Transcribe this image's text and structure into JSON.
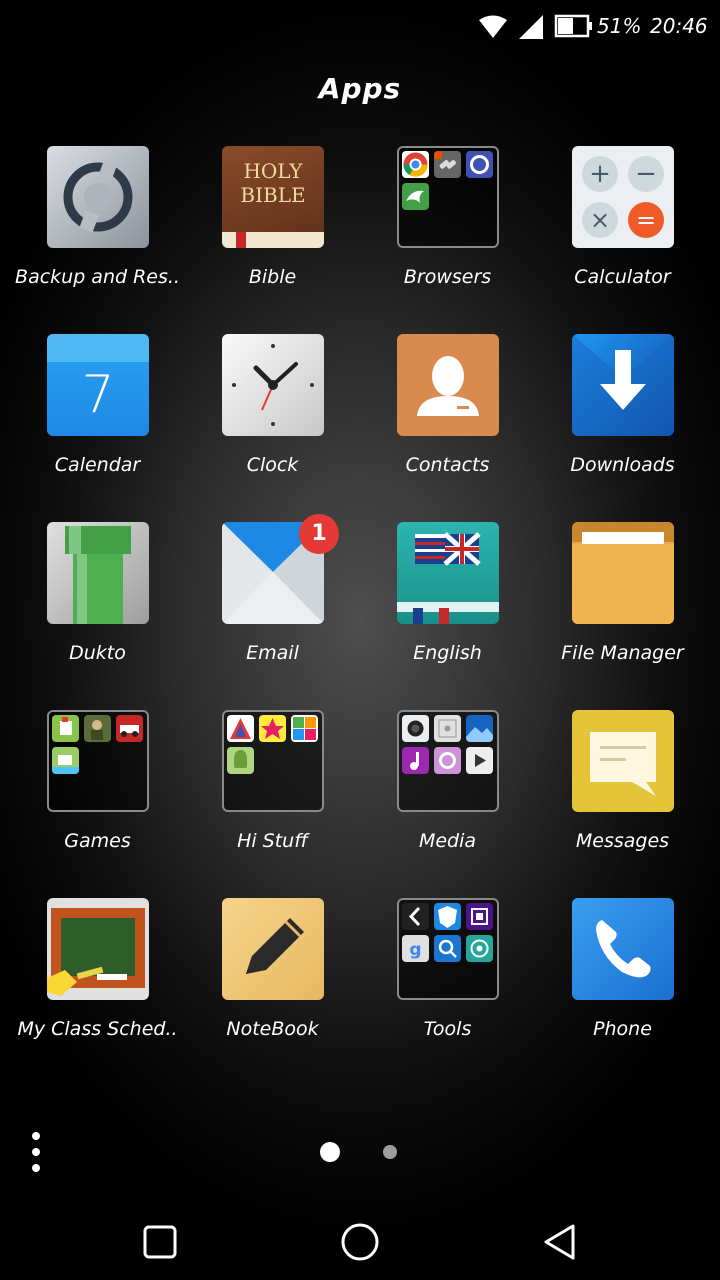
{
  "status_bar": {
    "battery": "51%",
    "time": "20:46",
    "wifi_icon": "wifi-icon",
    "signal_icon": "signal-icon",
    "battery_icon": "battery-icon"
  },
  "page": {
    "title": "Apps"
  },
  "apps": [
    {
      "label": "Backup and Res..",
      "icon": "backup-restore-icon"
    },
    {
      "label": "Bible",
      "icon": "holy-bible-icon",
      "icon_text_1": "HOLY",
      "icon_text_2": "BIBLE"
    },
    {
      "label": "Browsers",
      "icon": "folder-icon"
    },
    {
      "label": "Calculator",
      "icon": "calculator-icon"
    },
    {
      "label": "Calendar",
      "icon": "calendar-icon",
      "icon_text": "7"
    },
    {
      "label": "Clock",
      "icon": "clock-icon"
    },
    {
      "label": "Contacts",
      "icon": "contacts-icon"
    },
    {
      "label": "Downloads",
      "icon": "downloads-icon"
    },
    {
      "label": "Dukto",
      "icon": "pipe-icon"
    },
    {
      "label": "Email",
      "icon": "email-icon",
      "badge": "1"
    },
    {
      "label": "English",
      "icon": "dictionary-flag-icon"
    },
    {
      "label": "File Manager",
      "icon": "file-folder-icon"
    },
    {
      "label": "Games",
      "icon": "folder-icon"
    },
    {
      "label": "Hi Stuff",
      "icon": "folder-icon"
    },
    {
      "label": "Media",
      "icon": "folder-icon"
    },
    {
      "label": "Messages",
      "icon": "message-icon"
    },
    {
      "label": "My Class Sched..",
      "icon": "chalkboard-icon"
    },
    {
      "label": "NoteBook",
      "icon": "pencil-icon"
    },
    {
      "label": "Tools",
      "icon": "folder-icon"
    },
    {
      "label": "Phone",
      "icon": "phone-icon"
    }
  ],
  "pagination": {
    "current": 1,
    "total": 2
  },
  "nav_bar": {
    "recents_icon": "square-recents-icon",
    "home_icon": "circle-home-icon",
    "back_icon": "triangle-back-icon"
  },
  "colors": {
    "calendar": "#2196f3",
    "contacts": "#d98a4f",
    "downloads": "#1a7fd4",
    "messages": "#e6c43a",
    "phone": "#2a8ee0",
    "badge": "#e53935"
  }
}
